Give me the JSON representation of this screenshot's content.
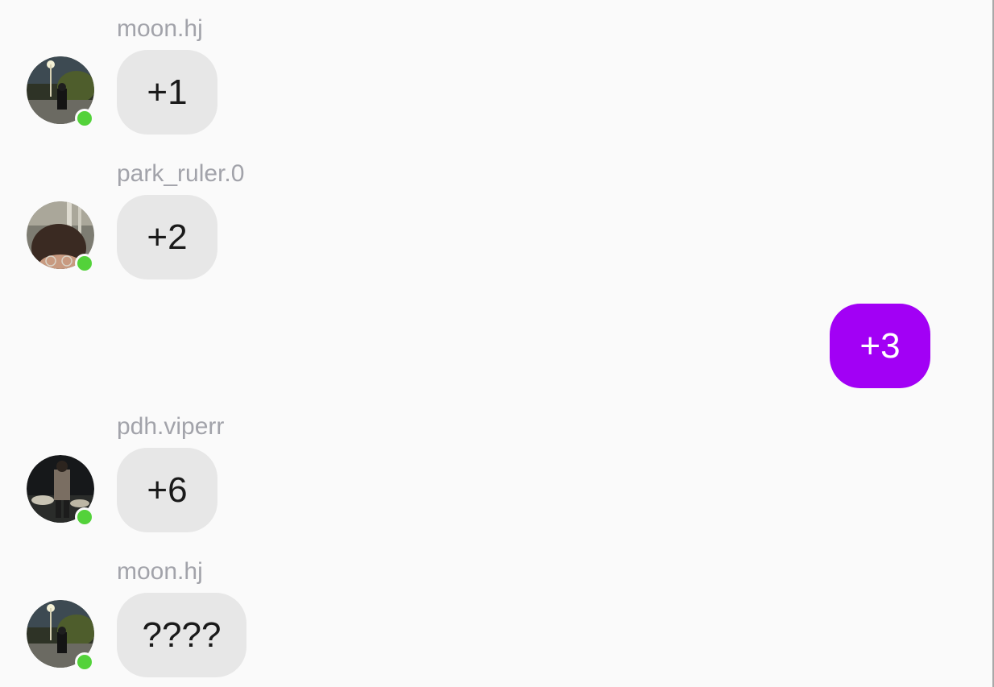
{
  "messages": [
    {
      "sender": "moon.hj",
      "text": "+1",
      "online": true
    },
    {
      "sender": "park_ruler.0",
      "text": "+2",
      "online": true
    },
    {
      "sender": "",
      "text": "+3",
      "outgoing": true
    },
    {
      "sender": "pdh.viperr",
      "text": "+6",
      "online": true
    },
    {
      "sender": "moon.hj",
      "text": "????",
      "online": true
    }
  ],
  "colors": {
    "background": "#fafafa",
    "incoming_bubble": "#e7e7e7",
    "outgoing_bubble": "#a200f5",
    "sender_name": "#a2a3aa",
    "online_indicator": "#53d23a"
  }
}
